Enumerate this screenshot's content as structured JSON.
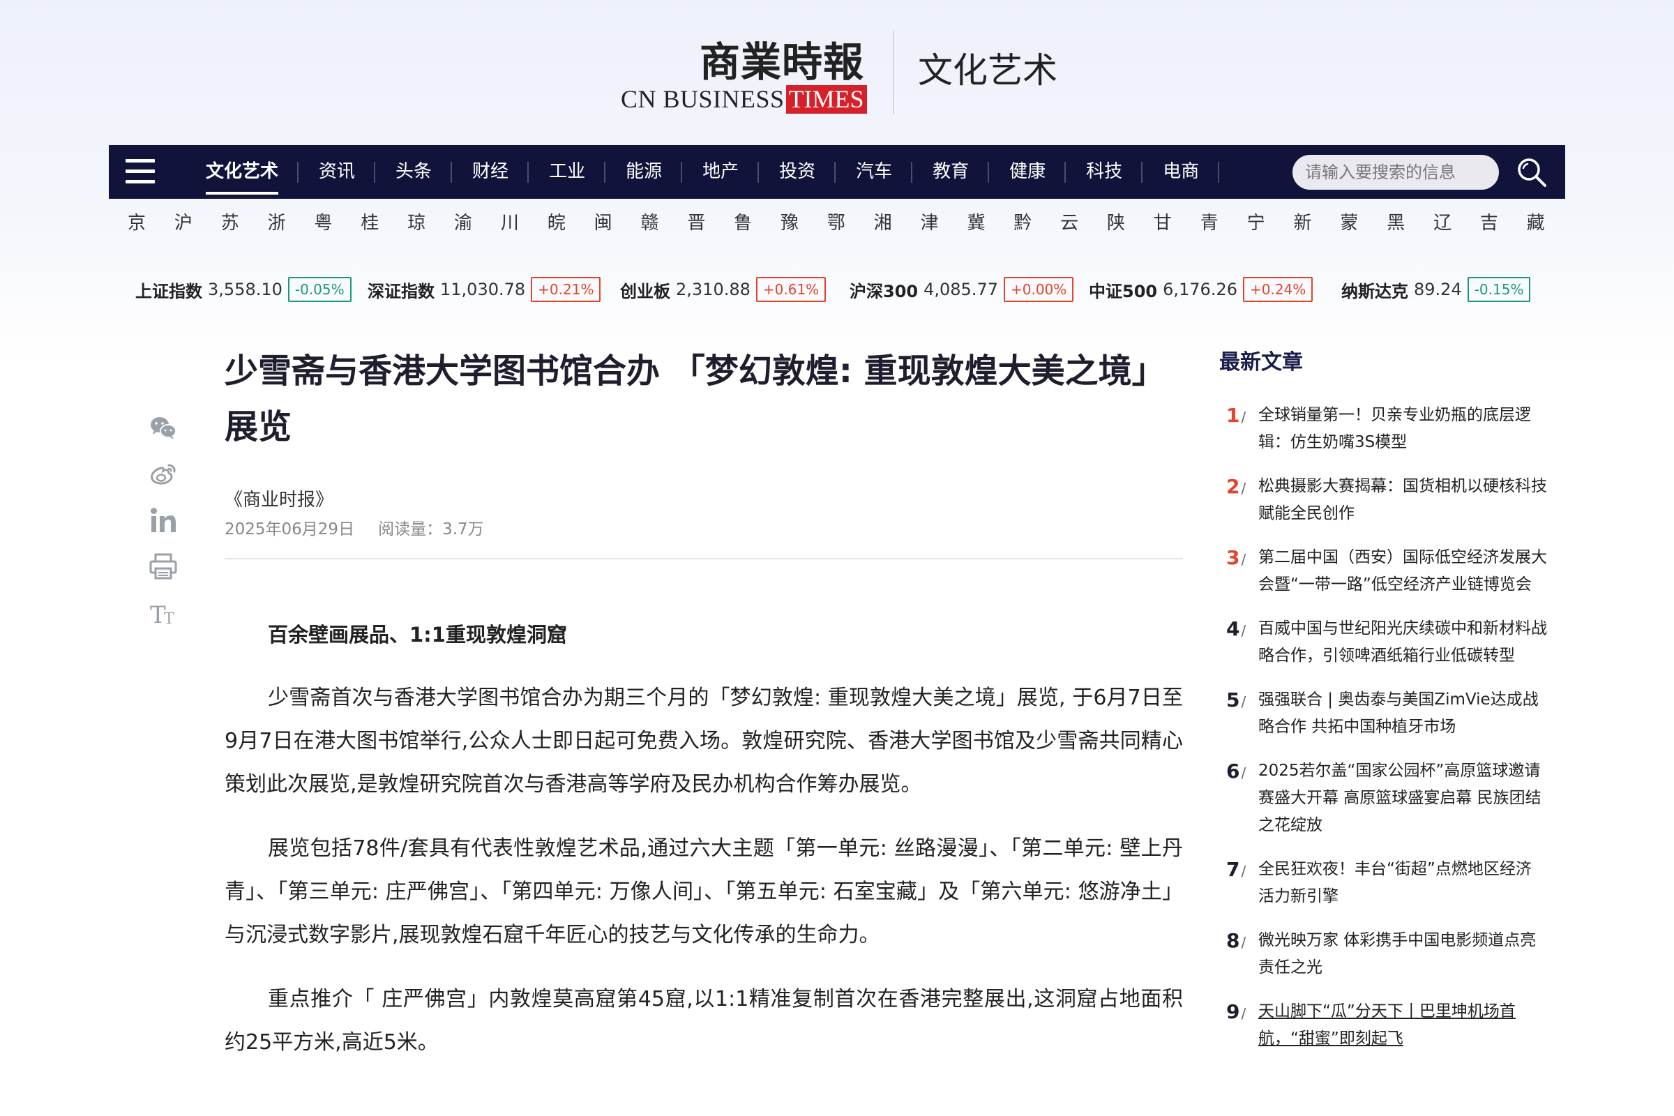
{
  "header": {
    "logo_cn": "商業時報",
    "logo_en_main": "CN BUSINESS",
    "logo_en_accent": "TIMES",
    "section_title": "文化艺术"
  },
  "nav": {
    "items": [
      "文化艺术",
      "资讯",
      "头条",
      "财经",
      "工业",
      "能源",
      "地产",
      "投资",
      "汽车",
      "教育",
      "健康",
      "科技",
      "电商"
    ],
    "active": "文化艺术",
    "search_placeholder": "请输入要搜索的信息"
  },
  "provinces": [
    "京",
    "沪",
    "苏",
    "浙",
    "粤",
    "桂",
    "琼",
    "渝",
    "川",
    "皖",
    "闽",
    "赣",
    "晋",
    "鲁",
    "豫",
    "鄂",
    "湘",
    "津",
    "冀",
    "黔",
    "云",
    "陕",
    "甘",
    "青",
    "宁",
    "新",
    "蒙",
    "黑",
    "辽",
    "吉",
    "藏"
  ],
  "tickers": [
    {
      "name": "上证指数",
      "value": "3,558.10",
      "change": "-0.05%",
      "direction": "down"
    },
    {
      "name": "深证指数",
      "value": "11,030.78",
      "change": "+0.21%",
      "direction": "up"
    },
    {
      "name": "创业板",
      "value": "2,310.88",
      "change": "+0.61%",
      "direction": "up"
    },
    {
      "name": "沪深300",
      "value": "4,085.77",
      "change": "+0.00%",
      "direction": "up"
    },
    {
      "name": "中证500",
      "value": "6,176.26",
      "change": "+0.24%",
      "direction": "up"
    },
    {
      "name": "纳斯达克",
      "value": "89.24",
      "change": "-0.15%",
      "direction": "down"
    }
  ],
  "share_icons": [
    "wechat-icon",
    "weibo-icon",
    "linkedin-icon",
    "print-icon",
    "font-size-icon"
  ],
  "article": {
    "title": "少雪斋与香港大学图书馆合办 「梦幻敦煌: 重现敦煌大美之境」展览",
    "source": "《商业时报》",
    "date": "2025年06月29日",
    "read_count": "阅读量：3.7万",
    "subhead": "百余壁画展品、1:1重现敦煌洞窟",
    "paragraphs": [
      "少雪斋首次与香港大学图书馆合办为期三个月的「梦幻敦煌: 重现敦煌大美之境」展览, 于6月7日至9月7日在港大图书馆举行,公众人士即日起可免费入场。敦煌研究院、香港大学图书馆及少雪斋共同精心策划此次展览,是敦煌研究院首次与香港高等学府及民办机构合作筹办展览。",
      "展览包括78件/套具有代表性敦煌艺术品,通过六大主题「第一单元: 丝路漫漫」、「第二单元: 壁上丹青」、「第三单元: 庄严佛宫」、「第四单元: 万像人间」、「第五单元: 石室宝藏」及「第六单元: 悠游净土」与沉浸式数字影片,展现敦煌石窟千年匠心的技艺与文化传承的生命力。",
      "重点推介「 庄严佛宫」内敦煌莫高窟第45窟,以1:1精准复制首次在香港完整展出,这洞窟占地面积约25平方米,高近5米。"
    ]
  },
  "sidebar": {
    "title": "最新文章",
    "items": [
      {
        "num": "1",
        "text": "全球销量第一！贝亲专业奶瓶的底层逻辑：仿生奶嘴3S模型"
      },
      {
        "num": "2",
        "text": "松典摄影大赛揭幕：国货相机以硬核科技赋能全民创作"
      },
      {
        "num": "3",
        "text": "第二届中国（西安）国际低空经济发展大会暨“一带一路”低空经济产业链博览会"
      },
      {
        "num": "4",
        "text": "百威中国与世纪阳光庆续碳中和新材料战略合作，引领啤酒纸箱行业低碳转型"
      },
      {
        "num": "5",
        "text": "强强联合 | 奥齿泰与美国ZimVie达成战略合作 共拓中国种植牙市场"
      },
      {
        "num": "6",
        "text": "2025若尔盖“国家公园杯”高原篮球邀请赛盛大开幕 高原篮球盛宴启幕 民族团结之花绽放"
      },
      {
        "num": "7",
        "text": "全民狂欢夜！丰台“街超”点燃地区经济活力新引擎"
      },
      {
        "num": "8",
        "text": "微光映万家 体彩携手中国电影频道点亮责任之光"
      },
      {
        "num": "9",
        "text": "天山脚下“瓜”分天下丨巴里坤机场首航，“甜蜜”即刻起飞"
      }
    ]
  },
  "colors": {
    "nav_bg": "#11133a",
    "accent_red": "#e2452a",
    "accent_green": "#1a9a7a",
    "logo_red": "#d6202a"
  }
}
